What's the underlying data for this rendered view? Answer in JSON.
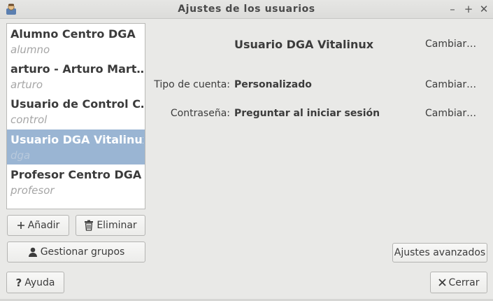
{
  "window": {
    "title": "Ajustes de los usuarios",
    "minimize_glyph": "–",
    "maximize_glyph": "+",
    "close_glyph": "✕"
  },
  "users": [
    {
      "name": "Alumno Centro DGA",
      "login": "alumno",
      "selected": false
    },
    {
      "name": "arturo - Arturo Mart…",
      "login": "arturo",
      "selected": false
    },
    {
      "name": "Usuario de Control C…",
      "login": "control",
      "selected": false
    },
    {
      "name": "Usuario DGA Vitalinux",
      "login": "dga",
      "selected": true
    },
    {
      "name": "Profesor Centro DGA",
      "login": "profesor",
      "selected": false
    }
  ],
  "details": {
    "full_name": "Usuario DGA Vitalinux",
    "change_label": "Cambiar…",
    "account_type_label": "Tipo de cuenta:",
    "account_type_value": "Personalizado",
    "password_label": "Contraseña:",
    "password_value": "Preguntar al iniciar sesión"
  },
  "buttons": {
    "add": "Añadir",
    "delete": "Eliminar",
    "manage_groups": "Gestionar grupos",
    "advanced": "Ajustes avanzados",
    "help": "Ayuda",
    "close": "Cerrar"
  },
  "icons": {
    "add": "plus-icon",
    "delete": "trash-icon",
    "manage_groups": "person-icon",
    "help": "question-icon",
    "close": "close-x-icon",
    "app": "users-app-icon"
  }
}
